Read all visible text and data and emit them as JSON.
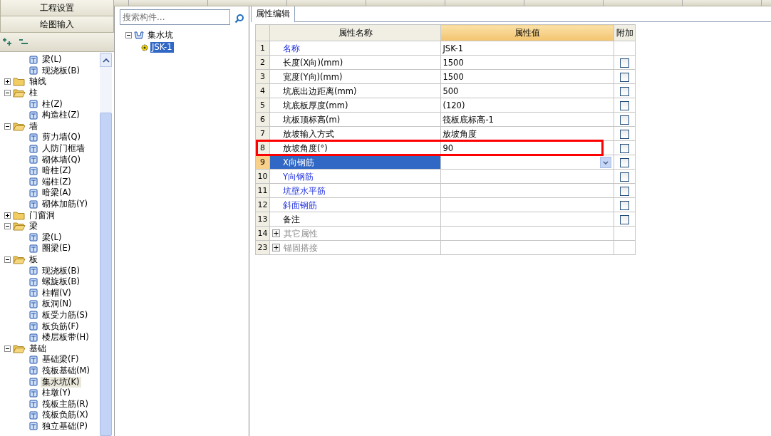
{
  "left_panel": {
    "buttons": [
      "工程设置",
      "绘图输入"
    ],
    "tree": {
      "continued": [
        {
          "label": "梁(L)",
          "selected": false
        },
        {
          "label": "现浇板(B)",
          "selected": false
        }
      ],
      "groups": [
        {
          "label": "轴线",
          "expanded": false
        },
        {
          "label": "柱",
          "expanded": true,
          "children": [
            {
              "label": "柱(Z)",
              "selected": false
            },
            {
              "label": "构造柱(Z)",
              "selected": false
            }
          ]
        },
        {
          "label": "墙",
          "expanded": true,
          "children": [
            {
              "label": "剪力墙(Q)",
              "selected": false
            },
            {
              "label": "人防门框墙",
              "selected": false
            },
            {
              "label": "砌体墙(Q)",
              "selected": false
            },
            {
              "label": "暗柱(Z)",
              "selected": false
            },
            {
              "label": "端柱(Z)",
              "selected": false
            },
            {
              "label": "暗梁(A)",
              "selected": false
            },
            {
              "label": "砌体加筋(Y)",
              "selected": false
            }
          ]
        },
        {
          "label": "门窗洞",
          "expanded": false
        },
        {
          "label": "梁",
          "expanded": true,
          "children": [
            {
              "label": "梁(L)",
              "selected": false
            },
            {
              "label": "圈梁(E)",
              "selected": false
            }
          ]
        },
        {
          "label": "板",
          "expanded": true,
          "children": [
            {
              "label": "现浇板(B)",
              "selected": false
            },
            {
              "label": "螺旋板(B)",
              "selected": false
            },
            {
              "label": "柱帽(V)",
              "selected": false
            },
            {
              "label": "板洞(N)",
              "selected": false
            },
            {
              "label": "板受力筋(S)",
              "selected": false
            },
            {
              "label": "板负筋(F)",
              "selected": false
            },
            {
              "label": "楼层板带(H)",
              "selected": false
            }
          ]
        },
        {
          "label": "基础",
          "expanded": true,
          "children": [
            {
              "label": "基础梁(F)",
              "selected": false
            },
            {
              "label": "筏板基础(M)",
              "selected": false
            },
            {
              "label": "集水坑(K)",
              "selected": true
            },
            {
              "label": "柱墩(Y)",
              "selected": false
            },
            {
              "label": "筏板主筋(R)",
              "selected": false
            },
            {
              "label": "筏板负筋(X)",
              "selected": false
            },
            {
              "label": "独立基础(P)",
              "selected": false
            }
          ]
        }
      ]
    }
  },
  "component_panel": {
    "search": {
      "placeholder": "搜索构件..."
    },
    "tree": [
      {
        "label": "集水坑",
        "expanded": true,
        "children": [
          {
            "label": "JSK-1",
            "selected": true
          }
        ]
      }
    ]
  },
  "properties": {
    "tab": {
      "label": "属性编辑",
      "selected": true
    },
    "columns": [
      {
        "label": "属性名称",
        "selected": false
      },
      {
        "label": "属性值",
        "selected": true
      },
      {
        "label": "附加",
        "selected": false
      }
    ],
    "rows": [
      {
        "num": "1",
        "name": "名称",
        "kind": "link",
        "value": "JSK-1",
        "selected": false,
        "highlighted": false
      },
      {
        "num": "2",
        "name": "长度(X向)(mm)",
        "kind": "plain",
        "value": "1500",
        "checked": false,
        "selected": false,
        "highlighted": false
      },
      {
        "num": "3",
        "name": "宽度(Y向)(mm)",
        "kind": "plain",
        "value": "1500",
        "checked": false,
        "selected": false,
        "highlighted": false
      },
      {
        "num": "4",
        "name": "坑底出边距离(mm)",
        "kind": "plain",
        "value": "500",
        "checked": false,
        "selected": false,
        "highlighted": false
      },
      {
        "num": "5",
        "name": "坑底板厚度(mm)",
        "kind": "plain",
        "value": "(120)",
        "checked": false,
        "selected": false,
        "highlighted": false
      },
      {
        "num": "6",
        "name": "坑板顶标高(m)",
        "kind": "plain",
        "value": "筏板底标高-1",
        "checked": false,
        "selected": false,
        "highlighted": false
      },
      {
        "num": "7",
        "name": "放坡输入方式",
        "kind": "plain",
        "value": "放坡角度",
        "checked": false,
        "selected": false,
        "highlighted": false
      },
      {
        "num": "8",
        "name": "放坡角度(°)",
        "kind": "plain",
        "value": "90",
        "checked": false,
        "selected": false,
        "highlighted": true
      },
      {
        "num": "9",
        "name": "X向钢筋",
        "kind": "link",
        "value": "",
        "checked": false,
        "selected": true,
        "highlighted": false
      },
      {
        "num": "10",
        "name": "Y向钢筋",
        "kind": "link",
        "value": "",
        "checked": false,
        "selected": false,
        "highlighted": false
      },
      {
        "num": "11",
        "name": "坑壁水平筋",
        "kind": "link",
        "value": "",
        "checked": false,
        "selected": false,
        "highlighted": false
      },
      {
        "num": "12",
        "name": "斜面钢筋",
        "kind": "link",
        "value": "",
        "checked": false,
        "selected": false,
        "highlighted": false
      },
      {
        "num": "13",
        "name": "备注",
        "kind": "plain",
        "value": "",
        "checked": false,
        "selected": false,
        "highlighted": false
      },
      {
        "num": "14",
        "name": "其它属性",
        "kind": "group",
        "value": "",
        "selected": false,
        "highlighted": false
      },
      {
        "num": "23",
        "name": "锚固搭接",
        "kind": "group",
        "value": "",
        "selected": false,
        "highlighted": false
      }
    ]
  }
}
